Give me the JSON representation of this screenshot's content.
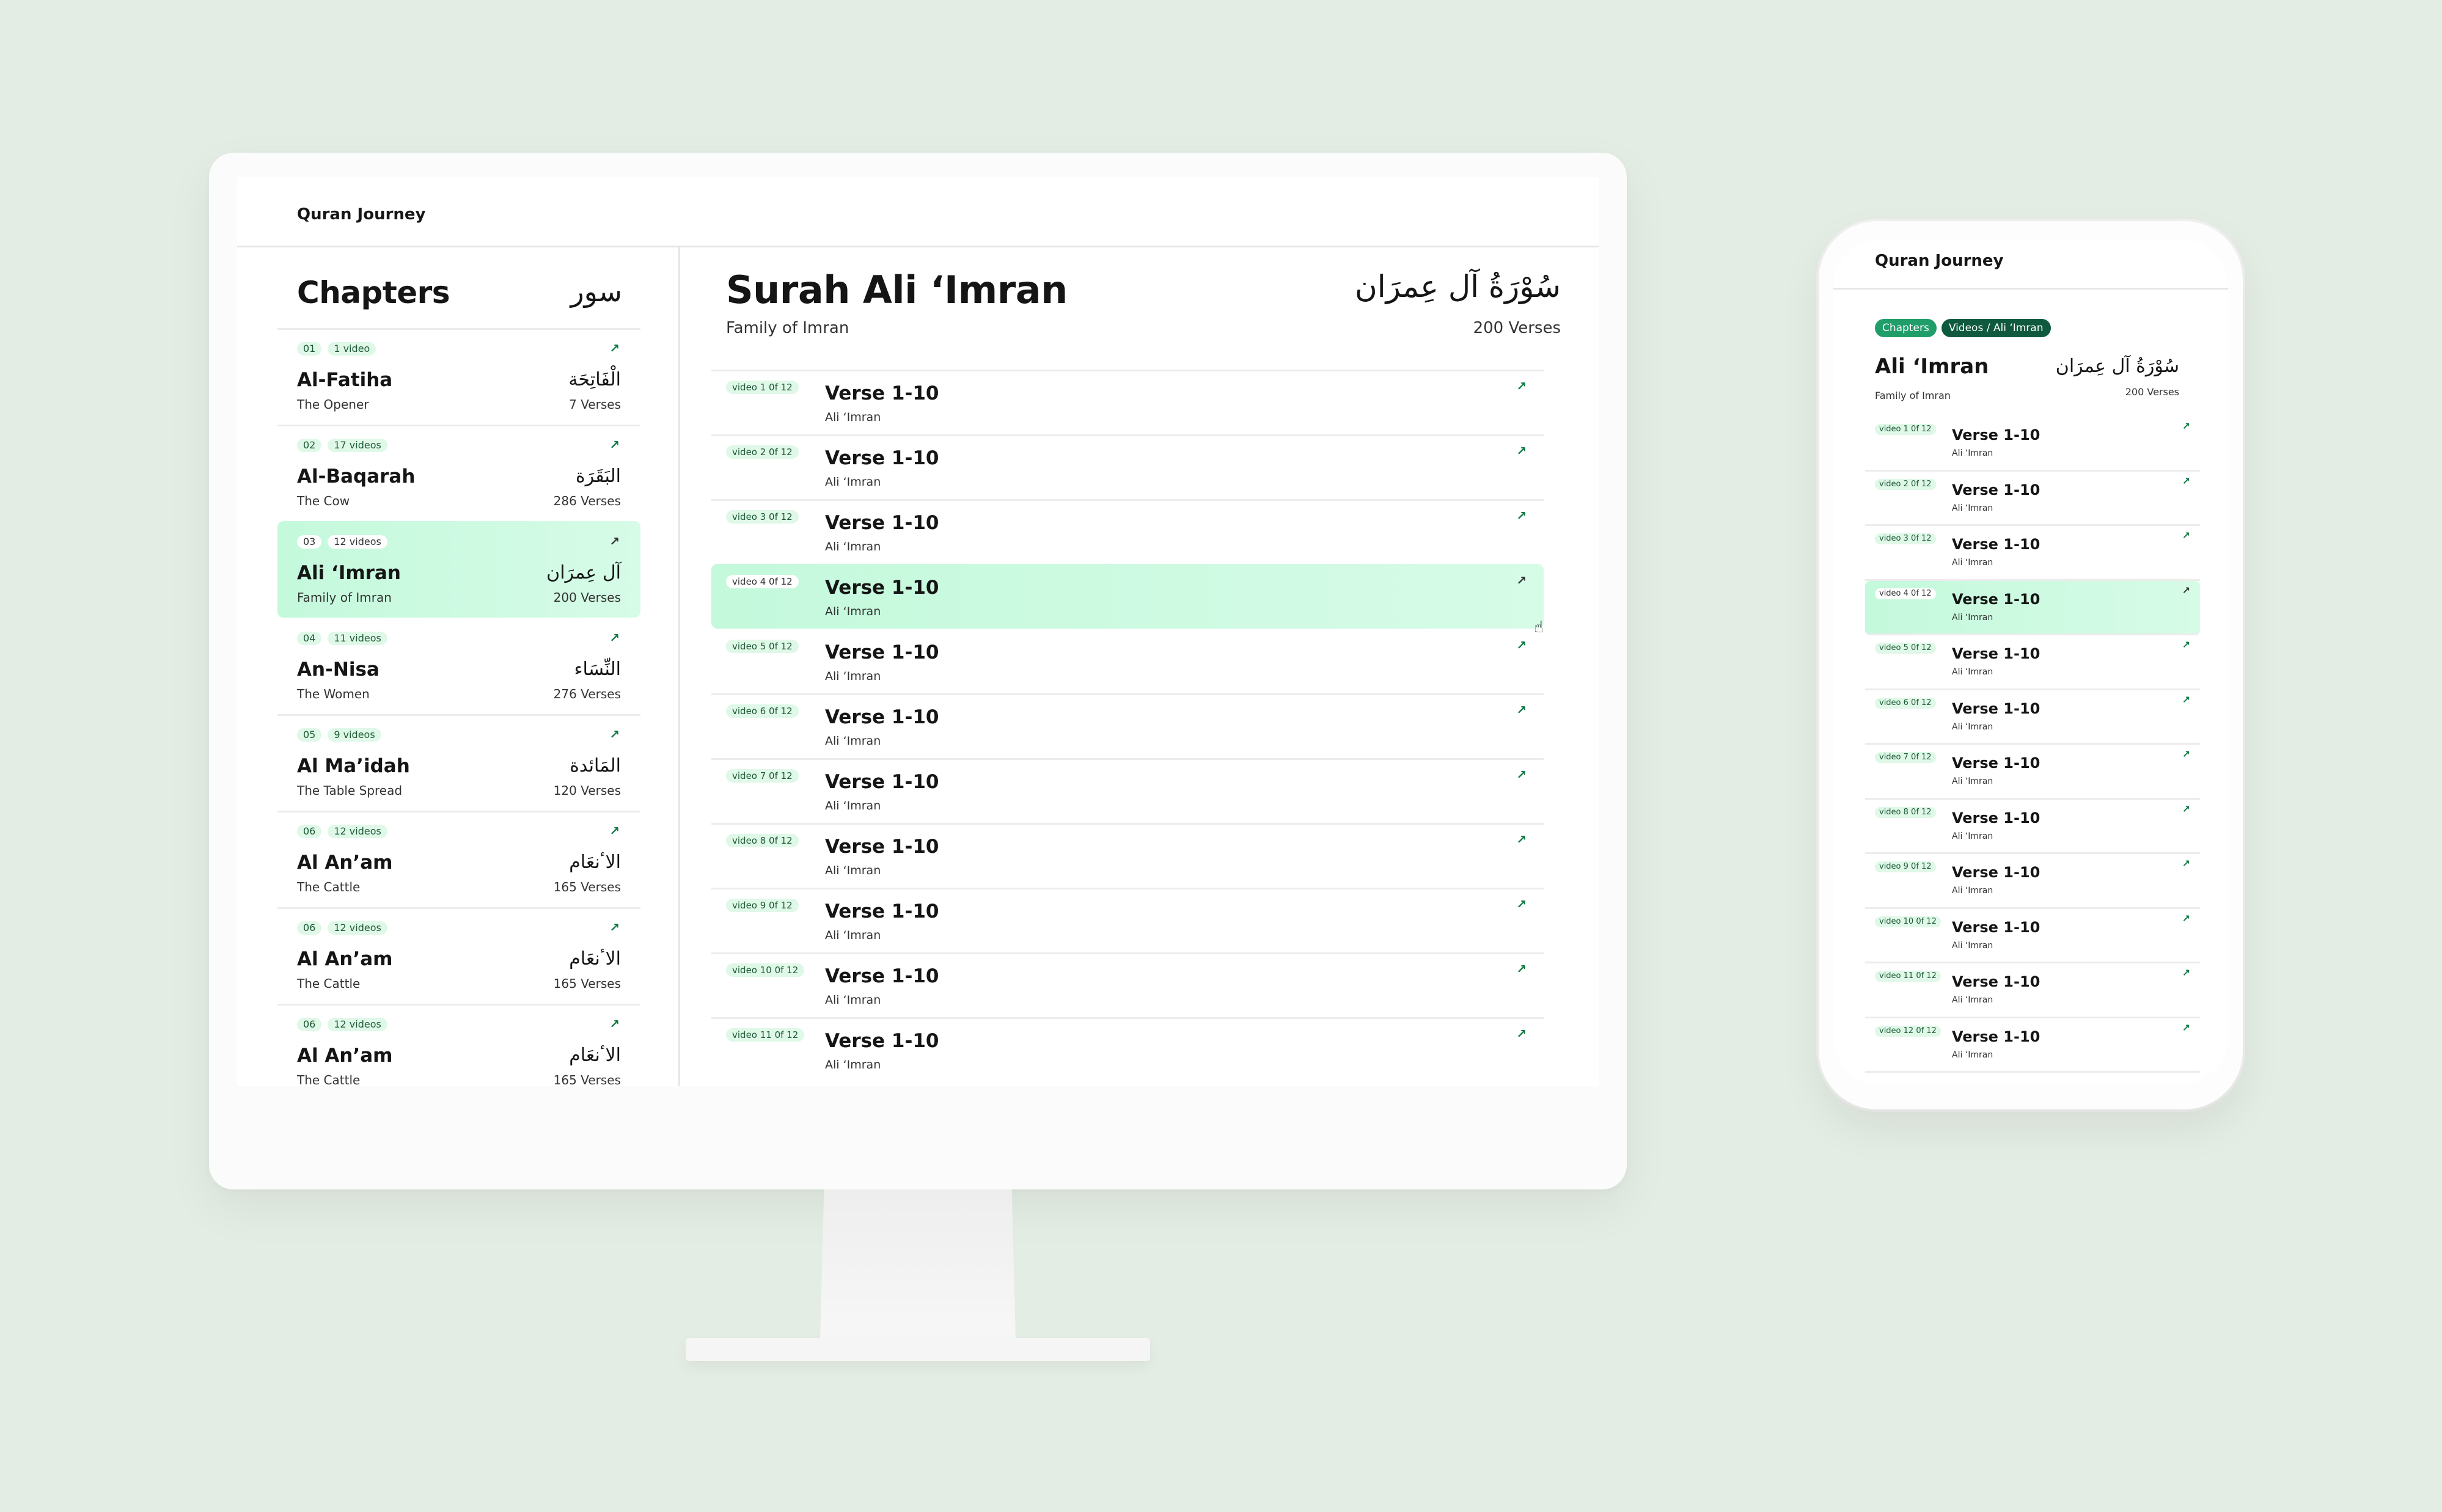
{
  "brand": "Quran Journey",
  "icons": {
    "open": "↗",
    "cursor": "☝"
  },
  "desktop": {
    "sidebar": {
      "title": "Chapters",
      "title_ar": "سور",
      "chapters": [
        {
          "num": "01",
          "videos": "1 video",
          "name": "Al-Fatiha",
          "sub": "The Opener",
          "ar": "الْفَاتِحَة",
          "verses": "7 Verses"
        },
        {
          "num": "02",
          "videos": "17 videos",
          "name": "Al-Baqarah",
          "sub": "The Cow",
          "ar": "البَقَرَة",
          "verses": "286 Verses"
        },
        {
          "num": "03",
          "videos": "12 videos",
          "name": "Ali ‘Imran",
          "sub": "Family of Imran",
          "ar": "آل عِمرَان",
          "verses": "200 Verses"
        },
        {
          "num": "04",
          "videos": "11 videos",
          "name": "An-Nisa",
          "sub": "The Women",
          "ar": "النِّسَاء",
          "verses": "276 Verses"
        },
        {
          "num": "05",
          "videos": "9 videos",
          "name": "Al Ma’idah",
          "sub": "The Table Spread",
          "ar": "المَائدة",
          "verses": "120 Verses"
        },
        {
          "num": "06",
          "videos": "12 videos",
          "name": "Al An’am",
          "sub": "The Cattle",
          "ar": "الاٴنعَام",
          "verses": "165 Verses"
        },
        {
          "num": "06",
          "videos": "12 videos",
          "name": "Al An’am",
          "sub": "The Cattle",
          "ar": "الاٴنعَام",
          "verses": "165 Verses"
        },
        {
          "num": "06",
          "videos": "12 videos",
          "name": "Al An’am",
          "sub": "The Cattle",
          "ar": "الاٴنعَام",
          "verses": "165 Verses"
        }
      ]
    },
    "main": {
      "title": "Surah Ali ‘Imran",
      "title_ar": "سُوْرَةُ آل عِمرَان",
      "subtitle": "Family of Imran",
      "verses": "200 Verses",
      "videos": [
        {
          "label": "video 1 0f 12",
          "title": "Verse 1-10",
          "sub": "Ali ‘Imran"
        },
        {
          "label": "video 2 0f 12",
          "title": "Verse 1-10",
          "sub": "Ali ‘Imran"
        },
        {
          "label": "video 3 0f 12",
          "title": "Verse 1-10",
          "sub": "Ali ‘Imran"
        },
        {
          "label": "video 4 0f 12",
          "title": "Verse 1-10",
          "sub": "Ali ‘Imran"
        },
        {
          "label": "video 5 0f 12",
          "title": "Verse 1-10",
          "sub": "Ali ‘Imran"
        },
        {
          "label": "video 6 0f 12",
          "title": "Verse 1-10",
          "sub": "Ali ‘Imran"
        },
        {
          "label": "video 7 0f 12",
          "title": "Verse 1-10",
          "sub": "Ali ‘Imran"
        },
        {
          "label": "video 8 0f 12",
          "title": "Verse 1-10",
          "sub": "Ali ‘Imran"
        },
        {
          "label": "video 9 0f 12",
          "title": "Verse 1-10",
          "sub": "Ali ‘Imran"
        },
        {
          "label": "video 10 0f 12",
          "title": "Verse 1-10",
          "sub": "Ali ‘Imran"
        },
        {
          "label": "video 11 0f 12",
          "title": "Verse 1-10",
          "sub": "Ali ‘Imran"
        }
      ]
    }
  },
  "mobile": {
    "breadcrumbs": [
      "Chapters",
      "Videos / Ali ‘Imran"
    ],
    "title": "Ali ‘Imran",
    "title_ar": "سُوْرَةُ آل عِمرَان",
    "subtitle": "Family of Imran",
    "verses": "200 Verses",
    "videos": [
      {
        "label": "video 1 0f 12",
        "title": "Verse 1-10",
        "sub": "Ali ‘Imran"
      },
      {
        "label": "video 2 0f 12",
        "title": "Verse 1-10",
        "sub": "Ali ‘Imran"
      },
      {
        "label": "video 3 0f 12",
        "title": "Verse 1-10",
        "sub": "Ali ‘Imran"
      },
      {
        "label": "video 4 0f 12",
        "title": "Verse 1-10",
        "sub": "Ali ‘Imran"
      },
      {
        "label": "video 5 0f 12",
        "title": "Verse 1-10",
        "sub": "Ali ‘Imran"
      },
      {
        "label": "video 6 0f 12",
        "title": "Verse 1-10",
        "sub": "Ali ‘Imran"
      },
      {
        "label": "video 7 0f 12",
        "title": "Verse 1-10",
        "sub": "Ali ‘Imran"
      },
      {
        "label": "video 8 0f 12",
        "title": "Verse 1-10",
        "sub": "Ali ‘Imran"
      },
      {
        "label": "video 9 0f 12",
        "title": "Verse 1-10",
        "sub": "Ali ‘Imran"
      },
      {
        "label": "video 10 0f 12",
        "title": "Verse 1-10",
        "sub": "Ali ‘Imran"
      },
      {
        "label": "video 11 0f 12",
        "title": "Verse 1-10",
        "sub": "Ali ‘Imran"
      },
      {
        "label": "video 12 0f 12",
        "title": "Verse 1-10",
        "sub": "Ali ‘Imran"
      }
    ]
  }
}
